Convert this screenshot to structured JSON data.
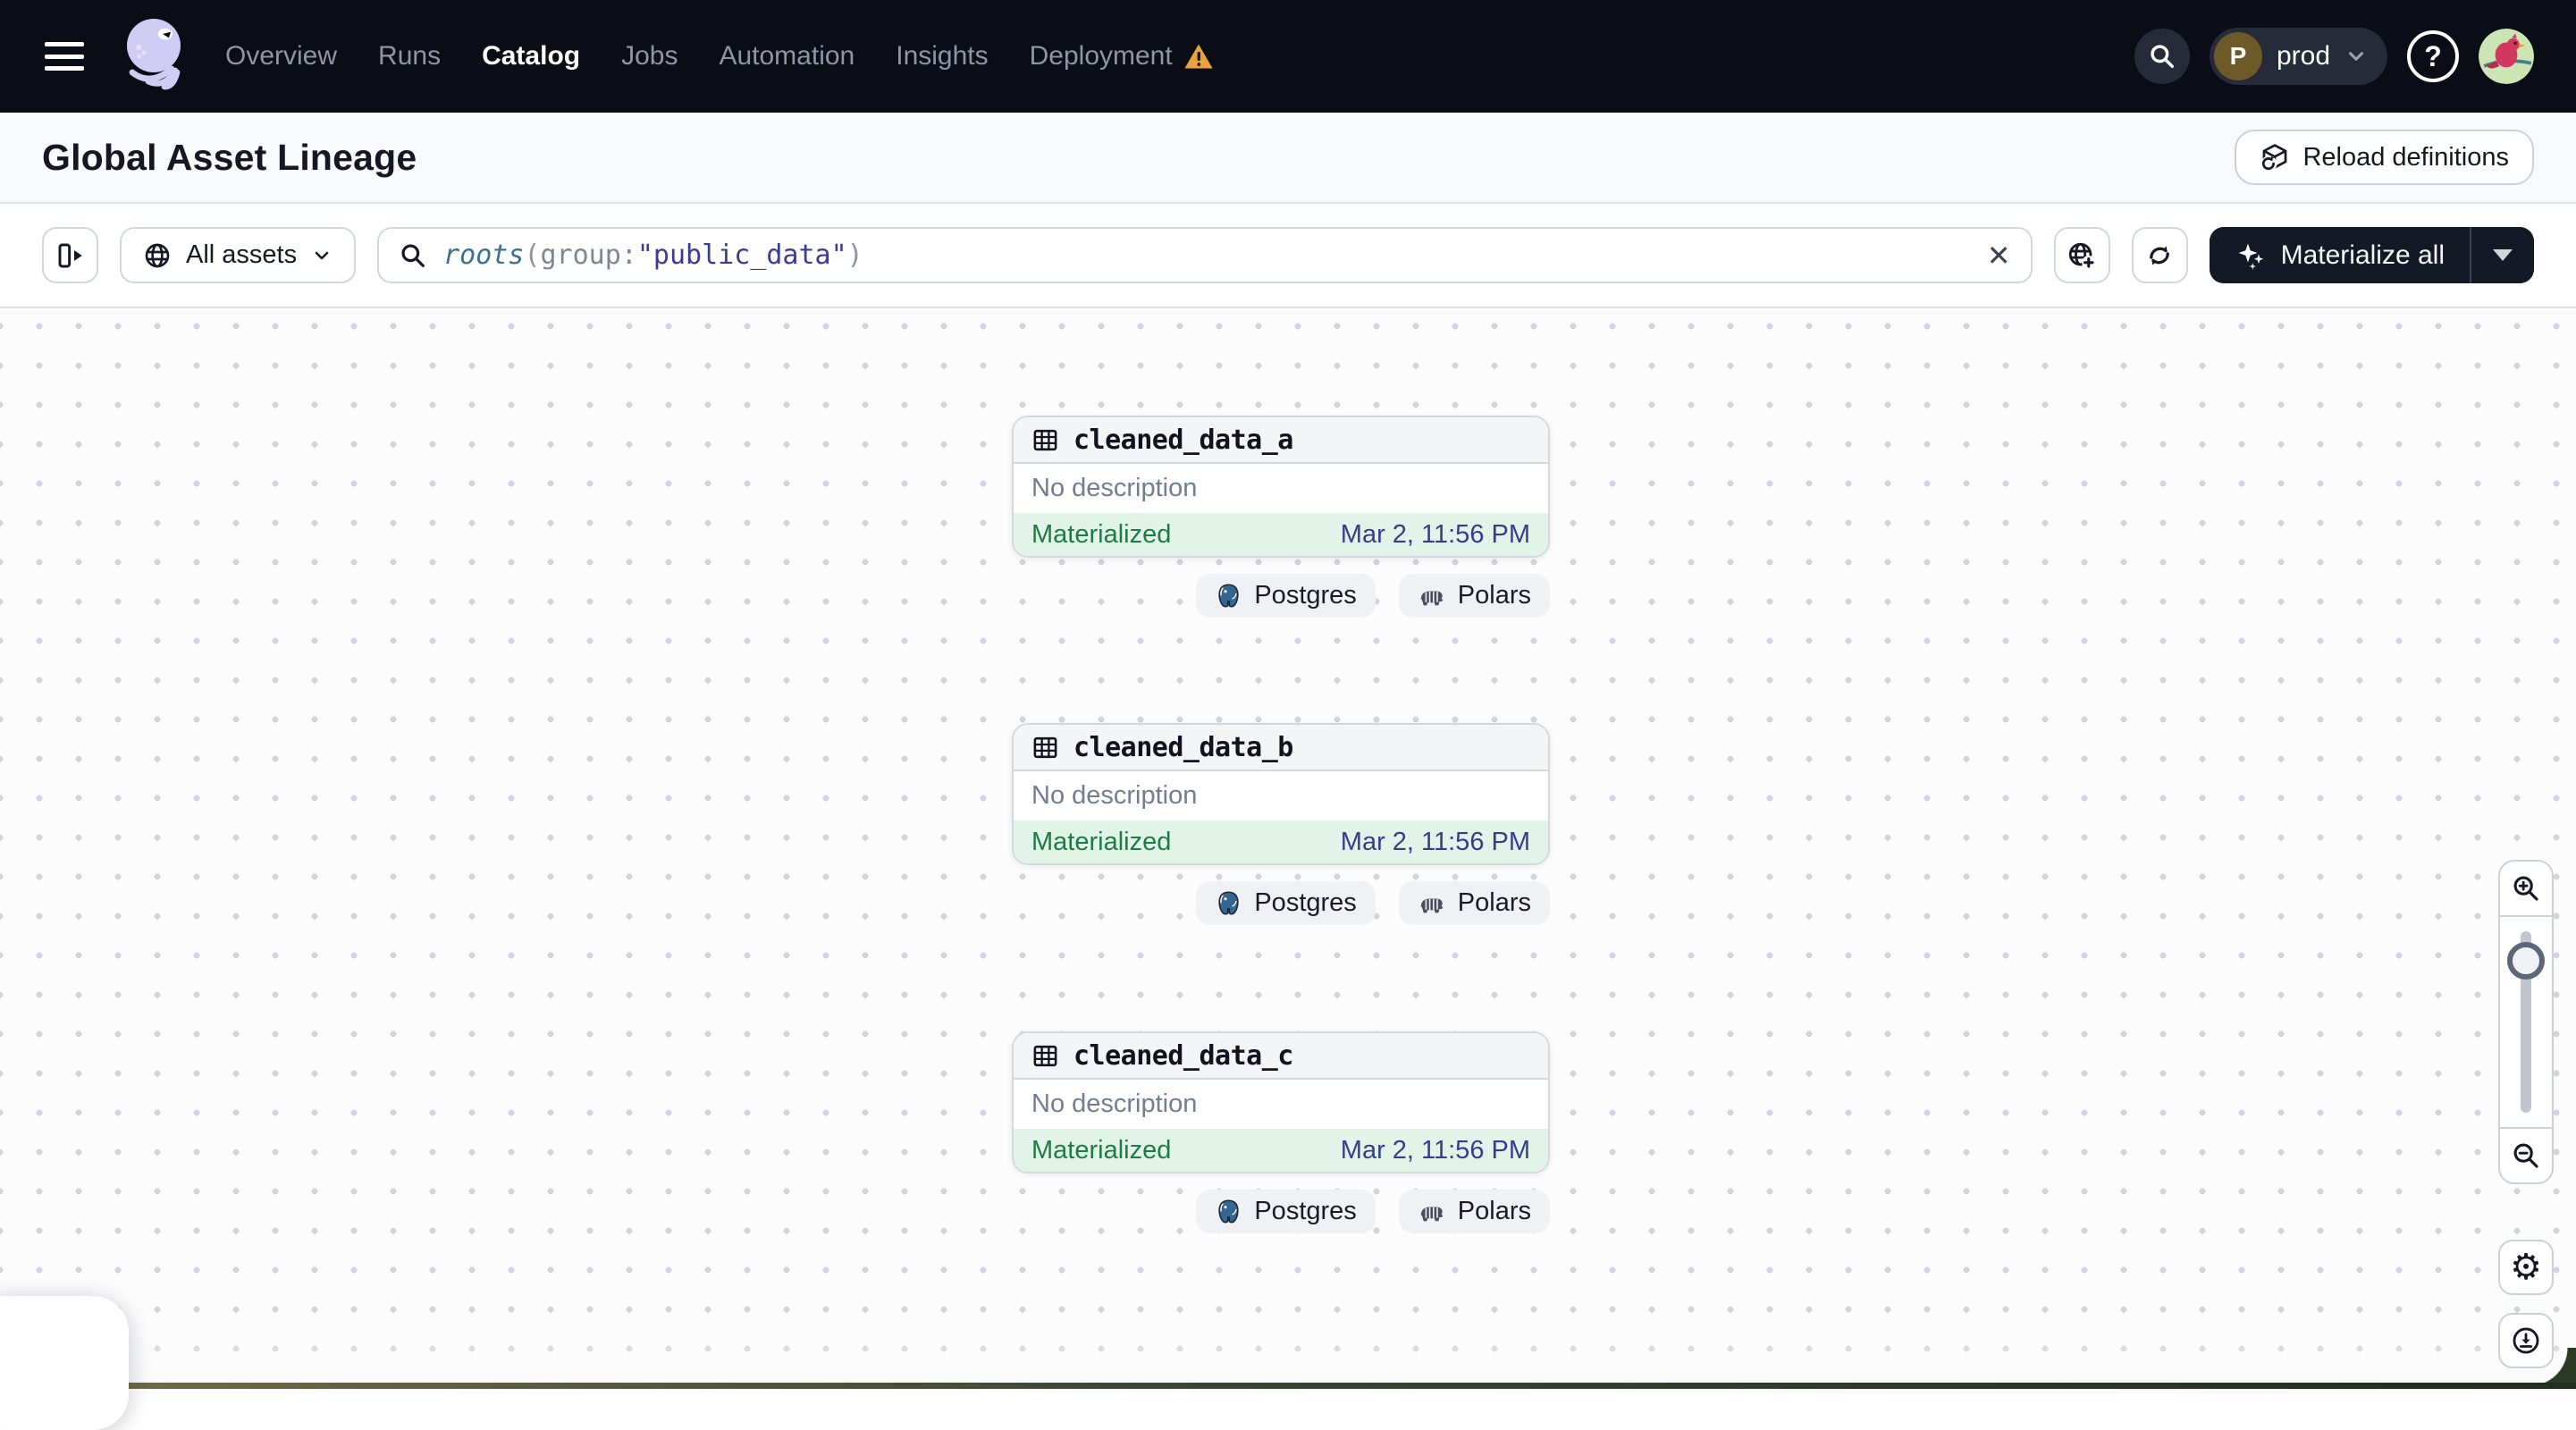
{
  "navbar": {
    "items": [
      "Overview",
      "Runs",
      "Catalog",
      "Jobs",
      "Automation",
      "Insights",
      "Deployment"
    ],
    "active_item": "Catalog",
    "environment": {
      "initial": "P",
      "name": "prod"
    }
  },
  "header": {
    "title": "Global Asset Lineage",
    "reload_button": "Reload definitions"
  },
  "toolbar": {
    "scope_button": "All assets",
    "query": {
      "fn": "roots",
      "open": "(",
      "key": "group",
      "colon": ":",
      "value": "\"public_data\"",
      "close": ")"
    },
    "clear": "✕",
    "materialize_button": "Materialize all"
  },
  "graph": {
    "nodes": [
      {
        "name": "cleaned_data_a",
        "description": "No description",
        "status": "Materialized",
        "materialized_at": "Mar 2, 11:56 PM",
        "tags": [
          "Postgres",
          "Polars"
        ]
      },
      {
        "name": "cleaned_data_b",
        "description": "No description",
        "status": "Materialized",
        "materialized_at": "Mar 2, 11:56 PM",
        "tags": [
          "Postgres",
          "Polars"
        ]
      },
      {
        "name": "cleaned_data_c",
        "description": "No description",
        "status": "Materialized",
        "materialized_at": "Mar 2, 11:56 PM",
        "tags": [
          "Postgres",
          "Polars"
        ]
      }
    ]
  },
  "colors": {
    "navbar_bg": "#0a0c16",
    "logo_lavender": "#cfcdf4",
    "warning_amber": "#e8a33d",
    "status_materialized_text": "#1d7c46",
    "status_materialized_bg": "#e2f4e8",
    "timestamp_indigo": "#363d8f",
    "query_function_teal": "#39718e",
    "query_value_indigo": "#3a3c94",
    "materialize_button_bg": "#141926"
  }
}
